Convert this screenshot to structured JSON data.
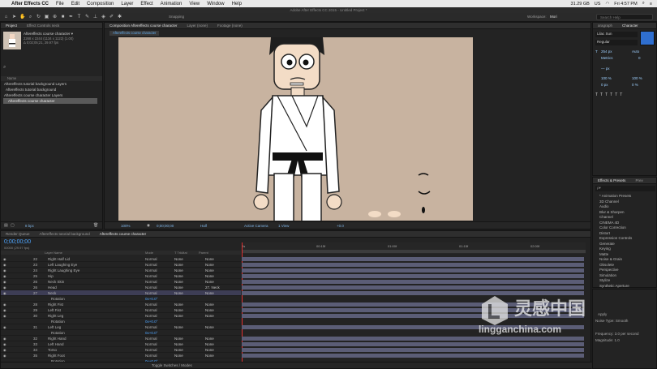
{
  "mac_menu": {
    "app": "After Effects CC",
    "items": [
      "File",
      "Edit",
      "Composition",
      "Layer",
      "Effect",
      "Animation",
      "View",
      "Window",
      "Help"
    ],
    "right": [
      "31.29 GB",
      "US",
      "Fri 4:57 PM"
    ],
    "colors": {
      "menubar": "#e9e9e9"
    }
  },
  "window_title": "Adobe After Effects CC 2015 - Untitled Project *",
  "toolbar": {
    "snapping": "Snapping",
    "workspace_label": "Workspace:",
    "workspace_value": "Mori",
    "search_placeholder": "Search Help"
  },
  "project_panel": {
    "tab": "Project",
    "tab2": "Effect Controls neck",
    "item_name": "Aftereffects course character ▾",
    "item_info": "2268 x 2244 (1134 x 1122) (1.00)",
    "item_info2": "Δ 0;02;05;21, 29.97 fps",
    "col_name": "Name",
    "items": [
      "Aftereffects tutorial background Layers",
      "Aftereffects tutorial background",
      "Aftereffects course character Layers",
      "Aftereffects course character"
    ],
    "footer": "8 bpc"
  },
  "comp_panel": {
    "tabs": [
      "Composition Aftereffects course character",
      "Layer (none)",
      "Footage (none)"
    ],
    "sub_tab": "Aftereffects course character",
    "zoom": "100%",
    "time": "0;00;00;00",
    "quality": "Half",
    "camera": "Active Camera",
    "view": "1 View",
    "offset": "+0.0",
    "bg_color": "#c8b3a0"
  },
  "character_panel": {
    "tabs": [
      "aragraph",
      "Character"
    ],
    "font": "Lilac Sun",
    "style": "Regular",
    "size": "254 px",
    "leading": "Auto",
    "kerning": "Metrics",
    "tracking": "0",
    "stroke": "— px",
    "vscale": "100 %",
    "hscale": "100 %",
    "baseline": "0 px",
    "tsume": "0 %"
  },
  "effects_panel": {
    "tabs": [
      "Effects & Presets",
      "Prev"
    ],
    "search_placeholder": "ρ▾",
    "items": [
      "* Animation Presets",
      "3D Channel",
      "Audio",
      "Blur & Sharpen",
      "Channel",
      "CINEMA 4D",
      "Color Correction",
      "Distort",
      "Expression Controls",
      "Generate",
      "Keying",
      "Matte",
      "Noise & Grain",
      "Obsolete",
      "Perspective",
      "Simulation",
      "Stylize",
      "Synthetic Aperture"
    ],
    "extra": [
      "Apply",
      "Noise Type: Smooth",
      "Frequency: 3.0 per second",
      "Magnitude: 1.0"
    ]
  },
  "timeline": {
    "tabs": [
      "Render Queue",
      "Aftereffects tutorial background",
      "Aftereffects course character"
    ],
    "timecode": "0;00;00;00",
    "fps": "00000 (29.97 fps)",
    "col_headers": [
      "Layer Name",
      "Mode",
      "T TrkMat",
      "Parent"
    ],
    "ruler": [
      "0s",
      "00:15f",
      "01:00f",
      "01:15f",
      "02:00f"
    ],
    "toggle_label": "Toggle Switches / Modes",
    "layers": [
      {
        "num": "22",
        "name": "Right Half Lid",
        "mode": "Normal",
        "trk": "None",
        "parent": "None"
      },
      {
        "num": "23",
        "name": "Left Laughing Eye",
        "mode": "Normal",
        "trk": "None",
        "parent": "None"
      },
      {
        "num": "24",
        "name": "Right Laughing Eye",
        "mode": "Normal",
        "trk": "None",
        "parent": "None"
      },
      {
        "num": "25",
        "name": "Hip",
        "mode": "Normal",
        "trk": "None",
        "parent": "None"
      },
      {
        "num": "26",
        "name": "Neck Skin",
        "mode": "Normal",
        "trk": "None",
        "parent": "None"
      },
      {
        "num": "26",
        "name": "Head",
        "mode": "Normal",
        "trk": "None",
        "parent": "27. Neck"
      },
      {
        "num": "27",
        "name": "Neck",
        "mode": "Normal",
        "trk": "None",
        "parent": "None"
      },
      {
        "num": "",
        "name": "Rotation",
        "mode": "0x+0.0°",
        "trk": "",
        "parent": ""
      },
      {
        "num": "28",
        "name": "Right Fist",
        "mode": "Normal",
        "trk": "None",
        "parent": "None"
      },
      {
        "num": "29",
        "name": "Left Fist",
        "mode": "Normal",
        "trk": "None",
        "parent": "None"
      },
      {
        "num": "30",
        "name": "Right Leg",
        "mode": "Normal",
        "trk": "None",
        "parent": "None"
      },
      {
        "num": "",
        "name": "Rotation",
        "mode": "0x+0.0°",
        "trk": "",
        "parent": ""
      },
      {
        "num": "31",
        "name": "Left Leg",
        "mode": "Normal",
        "trk": "None",
        "parent": "None"
      },
      {
        "num": "",
        "name": "Rotation",
        "mode": "0x+0.0°",
        "trk": "",
        "parent": ""
      },
      {
        "num": "32",
        "name": "Right Hand",
        "mode": "Normal",
        "trk": "None",
        "parent": "None"
      },
      {
        "num": "33",
        "name": "Left Hand",
        "mode": "Normal",
        "trk": "None",
        "parent": "None"
      },
      {
        "num": "34",
        "name": "Torso",
        "mode": "Normal",
        "trk": "None",
        "parent": "None"
      },
      {
        "num": "35",
        "name": "Right Foot",
        "mode": "Normal",
        "trk": "None",
        "parent": "None"
      },
      {
        "num": "",
        "name": "Rotation",
        "mode": "0x+0.0°",
        "trk": "",
        "parent": ""
      }
    ]
  },
  "watermark": {
    "cn": "灵感中国",
    "url": "lingganchina.com"
  }
}
